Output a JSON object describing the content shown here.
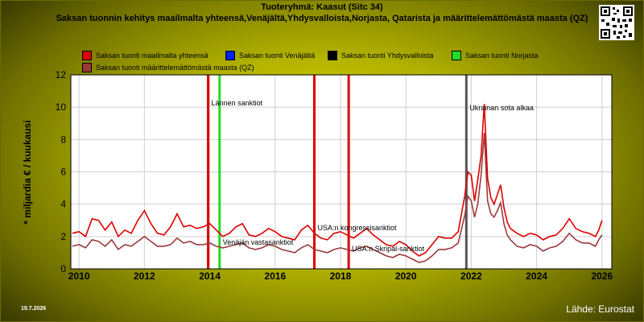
{
  "header": {
    "title": "Tuoteryhmä: Kaasut (Sitc 34)",
    "subtitle": "Saksan tuonnin kehitys maailmalta yhteensä,Venäjältä,Yhdysvalloista,Norjasta, Qatarista ja määrittelemättömästä maasta (QZ)"
  },
  "footer": {
    "date": "19.7.2026",
    "source": "Lähde: Eurostat"
  },
  "colors": {
    "total": "#dd0000",
    "russia": "#0022ee",
    "usa": "#000000",
    "norway": "#22dd22",
    "qz": "#9b3a3a"
  },
  "chart_data": {
    "type": "line",
    "ylabel": "* miljardia € / kuukausi",
    "xlabel": "",
    "ylim": [
      0,
      12
    ],
    "xlim": [
      2009.75,
      2026.3
    ],
    "y_ticks": [
      "0",
      "2",
      "4",
      "6",
      "8",
      "10",
      "12"
    ],
    "x_ticks": [
      "2010",
      "2012",
      "2014",
      "2016",
      "2018",
      "2020",
      "2022",
      "2024",
      "2026"
    ],
    "grid": true,
    "legend": [
      {
        "name": "Saksan tuonti maailmalta yhteensä",
        "color": "#dd0000"
      },
      {
        "name": "Saksan tuonti Venäjältä",
        "color": "#0022ee"
      },
      {
        "name": "Saksan tuonti Yhdysvalloista",
        "color": "#000000"
      },
      {
        "name": "Saksan tuonti Norjasta",
        "color": "#22dd22"
      },
      {
        "name": "Saksan tuonti määrittelemättömästä maasta (QZ)",
        "color": "#9b3a3a"
      }
    ],
    "events": [
      {
        "x": 2013.95,
        "label": "Lännen sanktiot",
        "color": "#dd0000",
        "label_y": 10.1
      },
      {
        "x": 2014.3,
        "label": "Venäjän vastasanktiot",
        "color": "#22dd22",
        "label_y": 1.5
      },
      {
        "x": 2017.2,
        "label": "USA:n kongressisanktiot",
        "color": "#dd0000",
        "label_y": 2.4
      },
      {
        "x": 2018.25,
        "label": "USA:n Skripal-sanktiot",
        "color": "#dd0000",
        "label_y": 1.1
      },
      {
        "x": 2021.85,
        "label": "Ukrainan sota alkaa",
        "color": "#555555",
        "label_y": 9.8
      }
    ],
    "series": [
      {
        "name": "Saksan tuonti maailmalta yhteensä",
        "color": "#dd0000",
        "x": [
          2009.8,
          2010.0,
          2010.2,
          2010.4,
          2010.6,
          2010.8,
          2011.0,
          2011.2,
          2011.4,
          2011.6,
          2011.8,
          2012.0,
          2012.2,
          2012.4,
          2012.6,
          2012.8,
          2013.0,
          2013.2,
          2013.4,
          2013.6,
          2013.8,
          2014.0,
          2014.2,
          2014.4,
          2014.6,
          2014.8,
          2015.0,
          2015.2,
          2015.4,
          2015.6,
          2015.8,
          2016.0,
          2016.2,
          2016.4,
          2016.6,
          2016.8,
          2017.0,
          2017.2,
          2017.4,
          2017.6,
          2017.8,
          2018.0,
          2018.2,
          2018.4,
          2018.6,
          2018.8,
          2019.0,
          2019.2,
          2019.4,
          2019.6,
          2019.8,
          2020.0,
          2020.2,
          2020.4,
          2020.6,
          2020.8,
          2021.0,
          2021.2,
          2021.4,
          2021.6,
          2021.8,
          2021.9,
          2022.0,
          2022.1,
          2022.2,
          2022.3,
          2022.4,
          2022.5,
          2022.6,
          2022.7,
          2022.8,
          2022.9,
          2023.0,
          2023.1,
          2023.2,
          2023.4,
          2023.6,
          2023.8,
          2024.0,
          2024.2,
          2024.4,
          2024.6,
          2024.8,
          2025.0,
          2025.2,
          2025.4,
          2025.6,
          2025.8,
          2025.9,
          2026.0
        ],
        "values": [
          2.2,
          2.3,
          2.0,
          3.1,
          3.0,
          2.4,
          2.9,
          2.0,
          2.4,
          2.2,
          3.0,
          3.6,
          2.8,
          2.2,
          2.1,
          2.6,
          3.4,
          2.6,
          2.7,
          2.5,
          2.6,
          2.8,
          2.4,
          2.0,
          2.2,
          2.6,
          2.8,
          2.1,
          2.0,
          2.2,
          2.5,
          2.3,
          2.0,
          1.9,
          1.8,
          2.4,
          2.7,
          2.2,
          1.9,
          1.8,
          2.2,
          2.3,
          2.1,
          1.9,
          2.2,
          2.5,
          2.1,
          1.8,
          1.5,
          1.4,
          1.7,
          1.5,
          1.1,
          0.8,
          1.0,
          1.5,
          2.0,
          1.9,
          1.9,
          2.3,
          4.5,
          6.0,
          5.8,
          4.2,
          5.5,
          7.0,
          10.2,
          5.6,
          4.4,
          4.0,
          4.6,
          5.2,
          3.8,
          2.9,
          2.5,
          2.2,
          2.0,
          2.2,
          2.1,
          1.8,
          2.0,
          2.1,
          2.5,
          3.1,
          2.5,
          2.3,
          2.2,
          2.0,
          2.4,
          3.0
        ]
      },
      {
        "name": "Saksan tuonti määrittelemättömästä maasta (QZ)",
        "color": "#9b3a3a",
        "x": [
          2009.8,
          2010.0,
          2010.2,
          2010.4,
          2010.6,
          2010.8,
          2011.0,
          2011.2,
          2011.4,
          2011.6,
          2011.8,
          2012.0,
          2012.2,
          2012.4,
          2012.6,
          2012.8,
          2013.0,
          2013.2,
          2013.4,
          2013.6,
          2013.8,
          2014.0,
          2014.2,
          2014.4,
          2014.6,
          2014.8,
          2015.0,
          2015.2,
          2015.4,
          2015.6,
          2015.8,
          2016.0,
          2016.2,
          2016.4,
          2016.6,
          2016.8,
          2017.0,
          2017.2,
          2017.4,
          2017.6,
          2017.8,
          2018.0,
          2018.2,
          2018.4,
          2018.6,
          2018.8,
          2019.0,
          2019.2,
          2019.4,
          2019.6,
          2019.8,
          2020.0,
          2020.2,
          2020.4,
          2020.6,
          2020.8,
          2021.0,
          2021.2,
          2021.4,
          2021.6,
          2021.8,
          2021.9,
          2022.0,
          2022.1,
          2022.2,
          2022.3,
          2022.4,
          2022.5,
          2022.6,
          2022.7,
          2022.8,
          2022.9,
          2023.0,
          2023.1,
          2023.2,
          2023.4,
          2023.6,
          2023.8,
          2024.0,
          2024.2,
          2024.4,
          2024.6,
          2024.8,
          2025.0,
          2025.2,
          2025.4,
          2025.6,
          2025.8,
          2025.9,
          2026.0
        ],
        "values": [
          1.4,
          1.5,
          1.3,
          1.8,
          1.7,
          1.4,
          1.8,
          1.2,
          1.5,
          1.4,
          1.7,
          2.0,
          1.7,
          1.4,
          1.4,
          1.5,
          1.9,
          1.6,
          1.7,
          1.5,
          1.5,
          1.6,
          1.4,
          1.3,
          1.4,
          1.5,
          1.6,
          1.3,
          1.2,
          1.3,
          1.5,
          1.4,
          1.2,
          1.1,
          1.0,
          1.3,
          1.5,
          1.2,
          1.1,
          1.0,
          1.2,
          1.3,
          1.2,
          1.1,
          1.3,
          1.4,
          1.2,
          1.0,
          0.8,
          0.7,
          0.9,
          0.8,
          0.6,
          0.4,
          0.5,
          0.8,
          1.2,
          1.2,
          1.3,
          1.6,
          3.3,
          4.5,
          4.2,
          3.2,
          4.0,
          5.8,
          8.4,
          4.2,
          3.4,
          3.2,
          3.6,
          4.1,
          2.8,
          2.1,
          1.8,
          1.4,
          1.3,
          1.5,
          1.4,
          1.1,
          1.3,
          1.4,
          1.7,
          2.2,
          1.8,
          1.6,
          1.6,
          1.4,
          1.8,
          2.1
        ]
      }
    ]
  }
}
